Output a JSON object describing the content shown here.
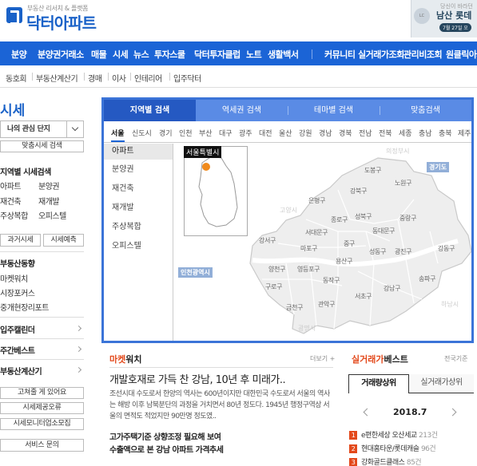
{
  "header": {
    "tagline": "부동산 리서치 & 플랫폼",
    "logo": "닥터아파트",
    "banner": {
      "sub": "당신이 바라던",
      "title": "남산 롯데",
      "date": "7월 27일 오"
    }
  },
  "nav": {
    "items": [
      "분양",
      "분양권거래소",
      "매물",
      "시세",
      "뉴스",
      "투자스쿨",
      "닥터투자클럽",
      "노트",
      "생활백서",
      "커뮤니티",
      "실거래가조회",
      "관리비조회",
      "원클릭아파트"
    ]
  },
  "subnav": {
    "items": [
      "동호회",
      "부동산계산기",
      "경매",
      "이사",
      "인테리어",
      "입주닥터"
    ]
  },
  "sidebar": {
    "title": "시세",
    "favorite": "나의 관심 단지",
    "quick_search": "맞춤시세 검색",
    "section_region": "지역별 시세검색",
    "links_a": [
      "아파트",
      "분양권"
    ],
    "links_b": [
      "재건축",
      "재개발"
    ],
    "links_c": [
      "주상복합",
      "오피스텔"
    ],
    "btn_past": "과거시세",
    "btn_forecast": "시세예측",
    "section_trend": "부동산동향",
    "trend_links": [
      "마켓워치",
      "시장포커스",
      "중개현장리포트"
    ],
    "calendar": "입주캘린더",
    "weekly": "주간베스트",
    "calculator": "부동산계산기",
    "btn_question": "고쳐줄 게 있어요",
    "btn_error": "시세제공오류",
    "btn_monitor": "시세모니터업소모집",
    "btn_service": "서비스 문의"
  },
  "tabs": [
    "지역별 검색",
    "역세권 검색",
    "테마별 검색",
    "맞춤검색"
  ],
  "regions": [
    "서울",
    "신도시",
    "경기",
    "인천",
    "부산",
    "대구",
    "광주",
    "대전",
    "울산",
    "강원",
    "경남",
    "경북",
    "전남",
    "전북",
    "세종",
    "충남",
    "충북",
    "제주"
  ],
  "types": [
    "아파트",
    "분양권",
    "재건축",
    "재개발",
    "주상복합",
    "오피스텔"
  ],
  "map": {
    "inset_label": "서울특별시",
    "tag_gyeonggi": "경기도",
    "tag_incheon": "인천광역시",
    "districts": [
      "도봉구",
      "노원구",
      "강북구",
      "은평구",
      "성북구",
      "종로구",
      "중랑구",
      "서대문구",
      "동대문구",
      "중구",
      "성동구",
      "광진구",
      "강동구",
      "마포구",
      "강서구",
      "용산구",
      "양천구",
      "영등포구",
      "동작구",
      "송파구",
      "구로구",
      "서초구",
      "강남구",
      "금천구",
      "관악구"
    ]
  },
  "market_watch": {
    "title_accent": "마켓",
    "title_rest": "워치",
    "more": "더보기 +",
    "headline": "개발호재로 가득 찬 강남, 10년 후 미래가..",
    "body": "조선시대 수도로서 한양의 역사는 600년이지만 대한민국 수도로서 서울의 역사는 해방 이후 남북분단의 과정을 거치면서 80년 정도다. 1945년 행정구역상 서울의 면적도 적었지만 90만명 정도였..",
    "link1": "고가주택기준 상향조정 필요해 보여",
    "link2": "수출액으로 본 강남 아파트 가격추세"
  },
  "best": {
    "title_accent": "실거래가",
    "title_rest": "베스트",
    "global": "전국기준",
    "tab_active": "거래량상위",
    "tab_inactive": "실거래가상위",
    "month": "2018.7",
    "rows": [
      {
        "rank": "1",
        "name": "e편한세상 오산세교",
        "count": "213건"
      },
      {
        "rank": "2",
        "name": "현대홈타운/롯데캐슬",
        "count": "96건"
      },
      {
        "rank": "3",
        "name": "강화골드클래스",
        "count": "85건"
      }
    ]
  },
  "colors": {
    "brand": "#1b64d6",
    "accent": "#e3491b",
    "tab_active": "#2559c2",
    "marker": "#f08a1c"
  }
}
